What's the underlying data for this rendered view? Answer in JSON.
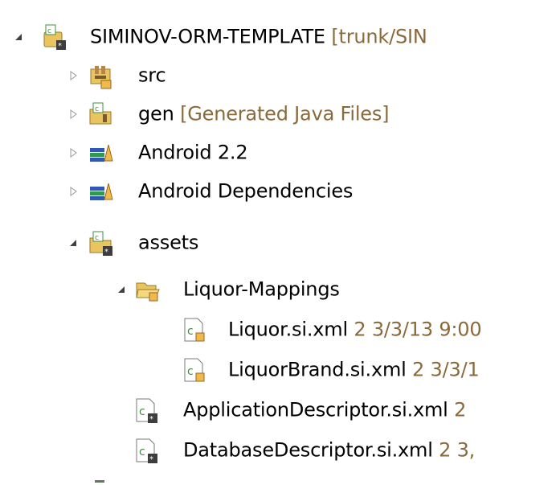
{
  "tree": {
    "rows": [
      {
        "label": "SIMINOV-ORM-TEMPLATE",
        "decoration": "[trunk/SIN",
        "icon": "project-icon",
        "expanded": true
      },
      {
        "label": "src",
        "decoration": "",
        "icon": "source-package-icon",
        "expanded": false
      },
      {
        "label": "gen",
        "decoration": "[Generated Java Files]",
        "icon": "generated-folder-icon",
        "expanded": false
      },
      {
        "label": "Android 2.2",
        "decoration": "",
        "icon": "library-icon",
        "expanded": false
      },
      {
        "label": "Android Dependencies",
        "decoration": "",
        "icon": "library-icon",
        "expanded": false
      },
      {
        "label": "assets",
        "decoration": "",
        "icon": "assets-folder-icon",
        "expanded": true
      },
      {
        "label": "Liquor-Mappings",
        "decoration": "",
        "icon": "open-folder-icon",
        "expanded": true
      },
      {
        "label": "Liquor.si.xml",
        "decoration": "2  3/3/13 9:00",
        "icon": "xml-file-icon"
      },
      {
        "label": "LiquorBrand.si.xml",
        "decoration": "2  3/3/1",
        "icon": "xml-file-icon"
      },
      {
        "label": "ApplicationDescriptor.si.xml",
        "decoration": "2",
        "icon": "xml-file-icon"
      },
      {
        "label": "DatabaseDescriptor.si.xml",
        "decoration": "2  3,",
        "icon": "xml-file-icon"
      }
    ]
  },
  "colors": {
    "decoration": "#8a6a3a",
    "folder": "#e9c45f",
    "library_green": "#2f9b4a",
    "library_blue": "#3656b4",
    "svn_badge": "#3d3d3d"
  }
}
